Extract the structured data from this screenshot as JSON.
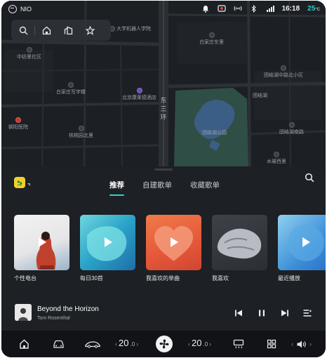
{
  "status_bar": {
    "brand": "NIO",
    "time": "16:18",
    "outside_temp": "25",
    "outside_temp_unit": "°C",
    "icons": [
      "bell-icon",
      "dashcam-icon",
      "wireless-icon",
      "bluetooth-icon",
      "signal-icon",
      "wifi-icon"
    ]
  },
  "map_toolbar": {
    "icons": [
      "search-icon",
      "home-icon",
      "company-icon",
      "favorites-icon"
    ]
  },
  "map": {
    "pois": [
      {
        "label": "大学机器人学院",
        "dot": "normal"
      },
      {
        "label": "中纺里社区",
        "dot": "normal"
      },
      {
        "label": "团结湖中路北小区",
        "dot": "normal"
      },
      {
        "label": "白家庄东里",
        "dot": "normal"
      },
      {
        "label": "白家庄写字楼",
        "dot": "normal"
      },
      {
        "label": "北京康莱德酒店",
        "dot": "purple"
      },
      {
        "label": "团结湖",
        "dot": "none"
      },
      {
        "label": "朝阳医院",
        "dot": "red"
      },
      {
        "label": "核桃园北里",
        "dot": "normal"
      },
      {
        "label": "团结湖公园",
        "dot": "none"
      },
      {
        "label": "团结湖南路",
        "dot": "normal"
      },
      {
        "label": "水碓西里",
        "dot": "normal"
      }
    ],
    "road_label": "东三环",
    "colors": {
      "park": "#2f4e45",
      "water": "#3b5e86",
      "road": "#3a3e44"
    }
  },
  "music": {
    "tabs": [
      {
        "label": "推荐",
        "active": true
      },
      {
        "label": "自建歌单",
        "active": false
      },
      {
        "label": "收藏歌单",
        "active": false
      }
    ],
    "cards": [
      {
        "title": "个性电台"
      },
      {
        "title": "每日30首"
      },
      {
        "title": "我喜欢的单曲"
      },
      {
        "title": "我喜欢"
      },
      {
        "title": "最近播放"
      }
    ],
    "now_playing": {
      "title": "Beyond the Horizon",
      "artist": "Tom Rosenthal"
    },
    "accent": "#2fd1c8"
  },
  "dock": {
    "left_temp": "20",
    "left_temp_decimal": ".0",
    "right_temp": "20",
    "right_temp_decimal": ".0",
    "icons": [
      "home-icon",
      "car-icon",
      "vehicle-control-icon",
      "fan-icon",
      "seat-heat-icon",
      "apps-grid-icon",
      "volume-icon"
    ]
  }
}
